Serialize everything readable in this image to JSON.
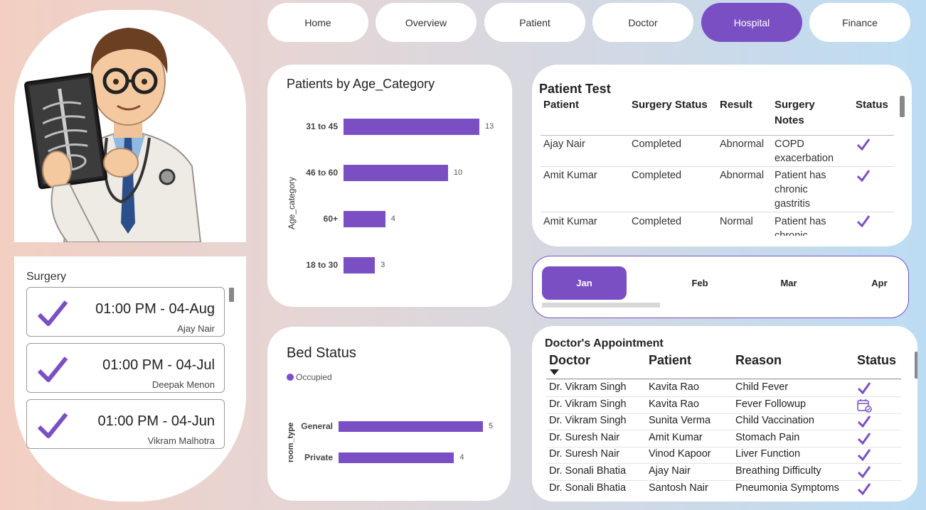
{
  "nav": [
    "Home",
    "Overview",
    "Patient",
    "Doctor",
    "Hospital",
    "Finance"
  ],
  "nav_active": "Hospital",
  "accent_color": "#7a4fc4",
  "surgery": {
    "title": "Surgery",
    "items": [
      {
        "time": "01:00 PM - 04-Aug",
        "name": "Ajay Nair"
      },
      {
        "time": "01:00 PM - 04-Jul",
        "name": "Deepak Menon"
      },
      {
        "time": "01:00 PM - 04-Jun",
        "name": "Vikram Malhotra"
      }
    ]
  },
  "age_chart": {
    "title": "Patients by Age_Category",
    "ylabel": "Age_category"
  },
  "bed_chart": {
    "title": "Bed Status",
    "legend": "Occupied",
    "ylabel": "room_type"
  },
  "chart_data": [
    {
      "type": "bar",
      "title": "Patients by Age_Category",
      "ylabel": "Age_category",
      "categories": [
        "31 to 45",
        "46 to 60",
        "60+",
        "18 to 30"
      ],
      "values": [
        13,
        10,
        4,
        3
      ]
    },
    {
      "type": "bar",
      "title": "Bed Status",
      "ylabel": "room_type",
      "categories": [
        "General",
        "Private"
      ],
      "series": [
        {
          "name": "Occupied",
          "values": [
            5,
            4
          ]
        }
      ]
    }
  ],
  "patient_test": {
    "title": "Patient Test",
    "headers": [
      "Patient",
      "Surgery Status",
      "Result",
      "Surgery Notes",
      "Status"
    ],
    "rows": [
      {
        "patient": "Ajay Nair",
        "status": "Completed",
        "result": "Abnormal",
        "notes": "COPD exacerbation"
      },
      {
        "patient": "Amit Kumar",
        "status": "Completed",
        "result": "Abnormal",
        "notes": "Patient has chronic gastritis"
      },
      {
        "patient": "Amit Kumar",
        "status": "Completed",
        "result": "Normal",
        "notes": "Patient has chronic"
      }
    ]
  },
  "months": [
    "Jan",
    "Feb",
    "Mar",
    "Apr"
  ],
  "month_active": "Jan",
  "appointments": {
    "title": "Doctor's Appointment",
    "headers": [
      "Doctor",
      "Patient",
      "Reason",
      "Status"
    ],
    "rows": [
      {
        "doctor": "Dr. Vikram Singh",
        "patient": "Kavita Rao",
        "reason": "Child Fever",
        "status": "check-icon"
      },
      {
        "doctor": "Dr. Vikram Singh",
        "patient": "Kavita Rao",
        "reason": "Fever Followup",
        "status": "calendar-icon"
      },
      {
        "doctor": "Dr. Vikram Singh",
        "patient": "Sunita Verma",
        "reason": "Child Vaccination",
        "status": "check-icon"
      },
      {
        "doctor": "Dr. Suresh Nair",
        "patient": "Amit Kumar",
        "reason": "Stomach Pain",
        "status": "check-icon"
      },
      {
        "doctor": "Dr. Suresh Nair",
        "patient": "Vinod Kapoor",
        "reason": "Liver Function",
        "status": "check-icon"
      },
      {
        "doctor": "Dr. Sonali Bhatia",
        "patient": "Ajay Nair",
        "reason": "Breathing Difficulty",
        "status": "check-icon"
      },
      {
        "doctor": "Dr. Sonali Bhatia",
        "patient": "Santosh Nair",
        "reason": "Pneumonia Symptoms",
        "status": "check-icon"
      }
    ]
  }
}
